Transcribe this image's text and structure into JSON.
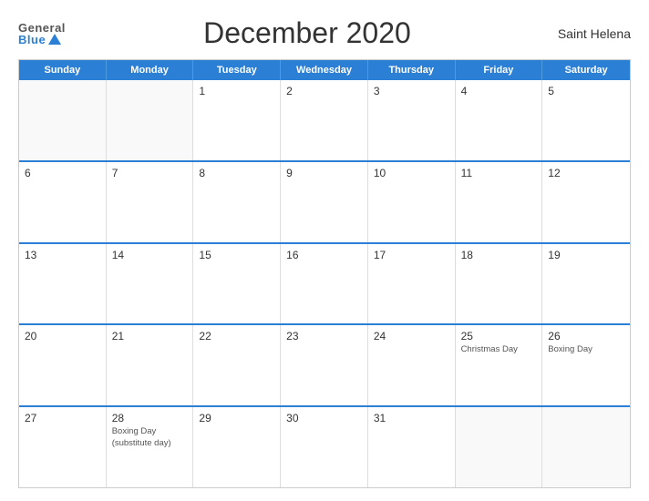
{
  "header": {
    "logo_general": "General",
    "logo_blue": "Blue",
    "title": "December 2020",
    "region": "Saint Helena"
  },
  "calendar": {
    "days_of_week": [
      "Sunday",
      "Monday",
      "Tuesday",
      "Wednesday",
      "Thursday",
      "Friday",
      "Saturday"
    ],
    "weeks": [
      [
        {
          "day": "",
          "empty": true
        },
        {
          "day": "",
          "empty": true
        },
        {
          "day": "1",
          "events": []
        },
        {
          "day": "2",
          "events": []
        },
        {
          "day": "3",
          "events": []
        },
        {
          "day": "4",
          "events": []
        },
        {
          "day": "5",
          "events": []
        }
      ],
      [
        {
          "day": "6",
          "events": []
        },
        {
          "day": "7",
          "events": []
        },
        {
          "day": "8",
          "events": []
        },
        {
          "day": "9",
          "events": []
        },
        {
          "day": "10",
          "events": []
        },
        {
          "day": "11",
          "events": []
        },
        {
          "day": "12",
          "events": []
        }
      ],
      [
        {
          "day": "13",
          "events": []
        },
        {
          "day": "14",
          "events": []
        },
        {
          "day": "15",
          "events": []
        },
        {
          "day": "16",
          "events": []
        },
        {
          "day": "17",
          "events": []
        },
        {
          "day": "18",
          "events": []
        },
        {
          "day": "19",
          "events": []
        }
      ],
      [
        {
          "day": "20",
          "events": []
        },
        {
          "day": "21",
          "events": []
        },
        {
          "day": "22",
          "events": []
        },
        {
          "day": "23",
          "events": []
        },
        {
          "day": "24",
          "events": []
        },
        {
          "day": "25",
          "events": [
            "Christmas Day"
          ]
        },
        {
          "day": "26",
          "events": [
            "Boxing Day"
          ]
        }
      ],
      [
        {
          "day": "27",
          "events": []
        },
        {
          "day": "28",
          "events": [
            "Boxing Day",
            "(substitute day)"
          ]
        },
        {
          "day": "29",
          "events": []
        },
        {
          "day": "30",
          "events": []
        },
        {
          "day": "31",
          "events": []
        },
        {
          "day": "",
          "empty": true
        },
        {
          "day": "",
          "empty": true
        }
      ]
    ]
  }
}
